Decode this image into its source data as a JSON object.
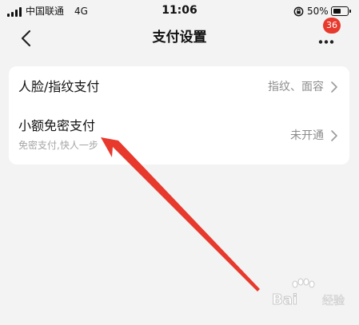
{
  "status_bar": {
    "carrier": "中国联通",
    "network": "4G",
    "time": "11:06",
    "battery": "50%",
    "icons": [
      "signal-icon",
      "orientation-lock-icon",
      "battery-icon"
    ]
  },
  "nav": {
    "title": "支付设置",
    "badge": "36",
    "icons": [
      "back-icon",
      "more-icon"
    ]
  },
  "rows": [
    {
      "title": "人脸/指纹支付",
      "value": "指纹、面容"
    },
    {
      "title": "小额免密支付",
      "subtitle": "免密支付,快人一步",
      "value": "未开通"
    }
  ],
  "colors": {
    "badge": "#e8392d",
    "arrow": "#e8392d",
    "background": "#f3f3f3",
    "card": "#ffffff"
  },
  "watermark": {
    "brand": "Bai",
    "suffix": "经验"
  }
}
